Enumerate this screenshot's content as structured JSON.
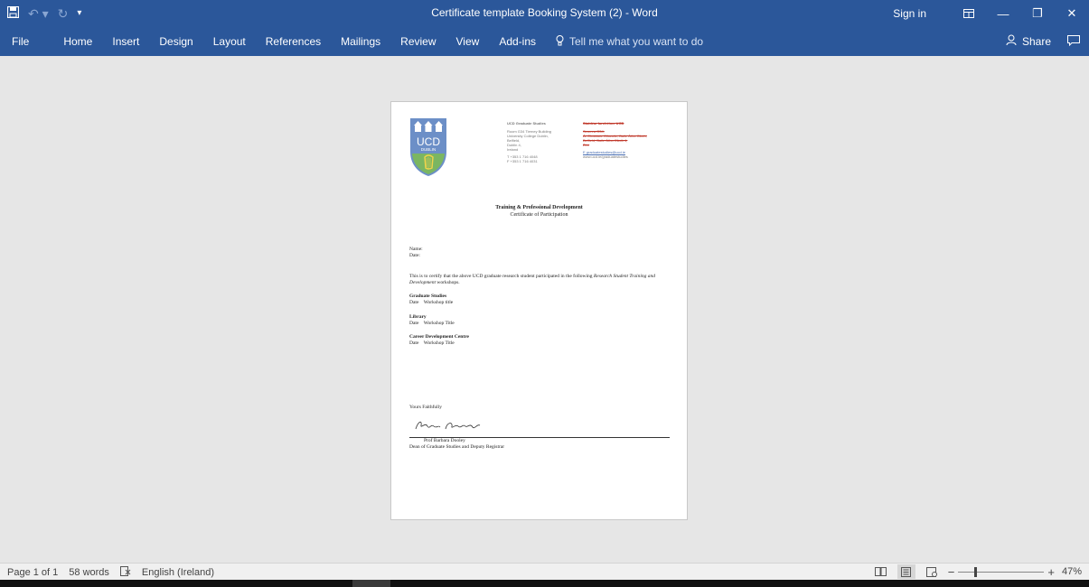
{
  "titlebar": {
    "doc_title": "Certificate template Booking System (2)  -  Word",
    "sign_in": "Sign in",
    "icons": [
      "save-icon",
      "undo-icon",
      "redo-icon",
      "customize-qat-icon",
      "ribbon-display-icon",
      "minimize-icon",
      "restore-icon",
      "close-icon"
    ]
  },
  "ribbon": {
    "tabs": [
      "File",
      "Home",
      "Insert",
      "Design",
      "Layout",
      "References",
      "Mailings",
      "Review",
      "View",
      "Add-ins"
    ],
    "tell_me": "Tell me what you want to do",
    "share": "Share"
  },
  "document": {
    "letterhead": {
      "dept": "UCD Graduate Studies",
      "address": [
        "Room G34 Tierney Building",
        "University College Dublin,",
        "Belfield,",
        "Dublin 4,",
        "Ireland"
      ],
      "phone": "T +353 1 716 4048",
      "fax": "F +353 1 716 4031",
      "dept_ga": "Staidéar Iarchéime UCD",
      "address_ga": [
        "Seomra G34,",
        "Ár Choláiste Ollscoile, Baile Átha Cliath,",
        "Belfield, Baile Átha Cliath 4,",
        "Éire"
      ],
      "email": "E graduatestudies@ucd.ie",
      "web": "www.ucd.ie/graduatestudies"
    },
    "cert_title": "Training & Professional Development",
    "cert_subtitle": "Certificate of Participation",
    "name_label": "Name:",
    "date_label": "Date:",
    "certify_text": "This is to certify that the above UCD graduate research student participated in the following",
    "certify_italic": "Research Student Training and Development",
    "certify_end": "workshops.",
    "sections": [
      {
        "heading": "Graduate Studies",
        "line": "Date    Workshop title"
      },
      {
        "heading": "Library",
        "line": "Date    Workshop Title"
      },
      {
        "heading": "Career Development Centre",
        "line": "Date    Workshop Title"
      }
    ],
    "closing": "Yours Faithfully",
    "signer": "Prof Barbara Dooley",
    "signer_role": "Dean of Graduate Studies and Deputy Registrar",
    "signature_script": "Barbara Dooley"
  },
  "status": {
    "page": "Page 1 of 1",
    "words": "58 words",
    "language": "English (Ireland)",
    "zoom": "47%",
    "zoom_value": 0.47
  },
  "colors": {
    "brand": "#2b579a",
    "ucd_blue": "#6c8fc7",
    "ucd_green": "#7bb661"
  }
}
